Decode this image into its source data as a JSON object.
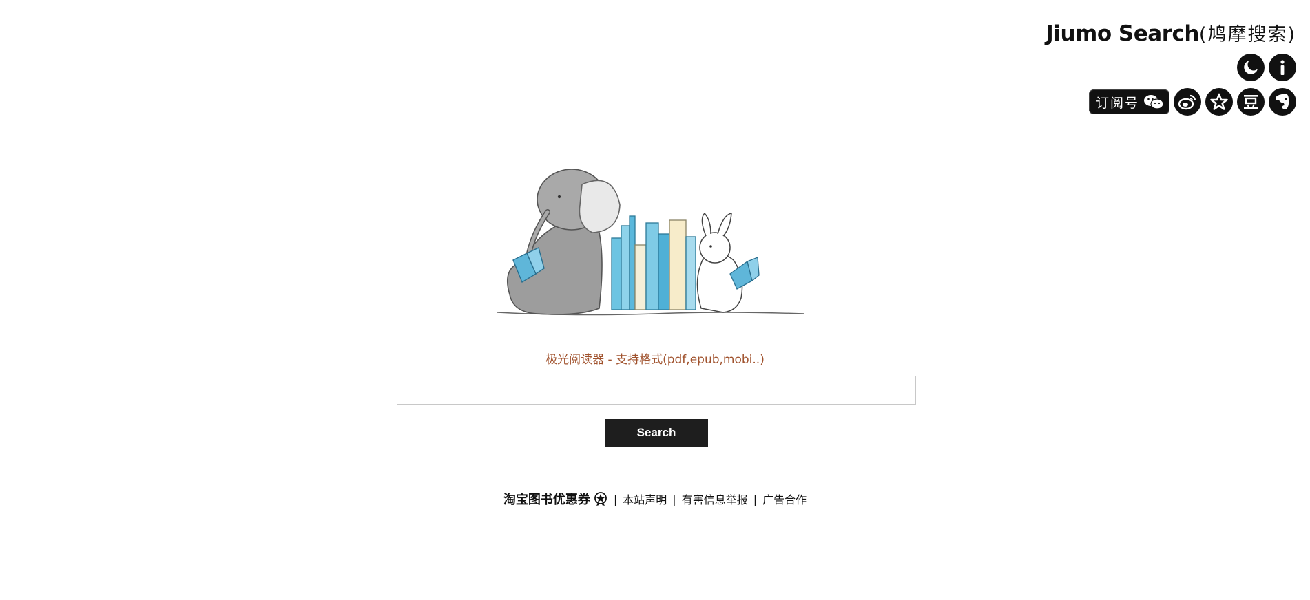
{
  "header": {
    "brand": "Jiumo Search",
    "brand_sub": "(鸠摩搜索)",
    "subscribe_label": "订阅号",
    "row1_icons": [
      "theme-moon-icon",
      "info-icon"
    ],
    "row2_icons": [
      "weibo-icon",
      "favorite-star-icon",
      "douban-icon",
      "evernote-icon"
    ]
  },
  "promo": {
    "text": "极光阅读器 - 支持格式(pdf,epub,mobi..)"
  },
  "search": {
    "value": "",
    "placeholder": "",
    "button_label": "Search"
  },
  "footer": {
    "taobao_label": "淘宝图书优惠券",
    "links": [
      "本站声明",
      "有害信息举报",
      "广告合作"
    ],
    "separator": "|"
  },
  "colors": {
    "promo": "#a0522d",
    "button_bg": "#1e1e1e",
    "icon_bg": "#111111"
  }
}
